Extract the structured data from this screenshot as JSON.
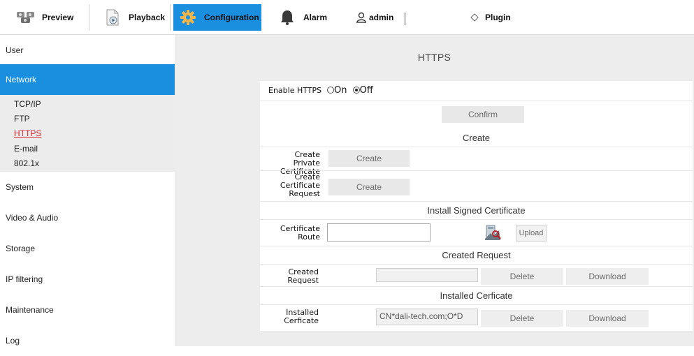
{
  "topbar": {
    "preview": "Preview",
    "playback": "Playback",
    "configuration": "Configuration",
    "alarm": "Alarm",
    "user": "admin",
    "plugin": "Plugin",
    "accent_color": "#1a8fe0"
  },
  "sidebar": {
    "items": [
      "User",
      "Network",
      "System",
      "Video & Audio",
      "Storage",
      "IP filtering",
      "Maintenance",
      "Log"
    ],
    "active": "Network",
    "network_sub": [
      "TCP/IP",
      "FTP",
      "HTTPS",
      "E-mail",
      "802.1x"
    ],
    "current_sub": "HTTPS"
  },
  "main": {
    "title": "HTTPS",
    "enable_label": "Enable HTTPS",
    "on_label": "On",
    "off_label": "Off",
    "enabled": false,
    "confirm": "Confirm",
    "create_section": "Create",
    "private_cert_label": [
      "Create Private",
      "Certificate"
    ],
    "cert_request_label": [
      "Create",
      "Certificate",
      "Request"
    ],
    "create_button": "Create",
    "install_section": "Install Signed Certificate",
    "route_label": [
      "Certificate",
      "Route"
    ],
    "route_value": "",
    "upload": "Upload",
    "created_request_section": "Created Request",
    "created_request_label": [
      "Created",
      "Request"
    ],
    "created_request_value": "",
    "delete": "Delete",
    "download": "Download",
    "installed_section": "Installed Cerficate",
    "installed_label": [
      "Installed",
      "Cerficate"
    ],
    "installed_value": "CN*dali-tech.com;O*D"
  }
}
